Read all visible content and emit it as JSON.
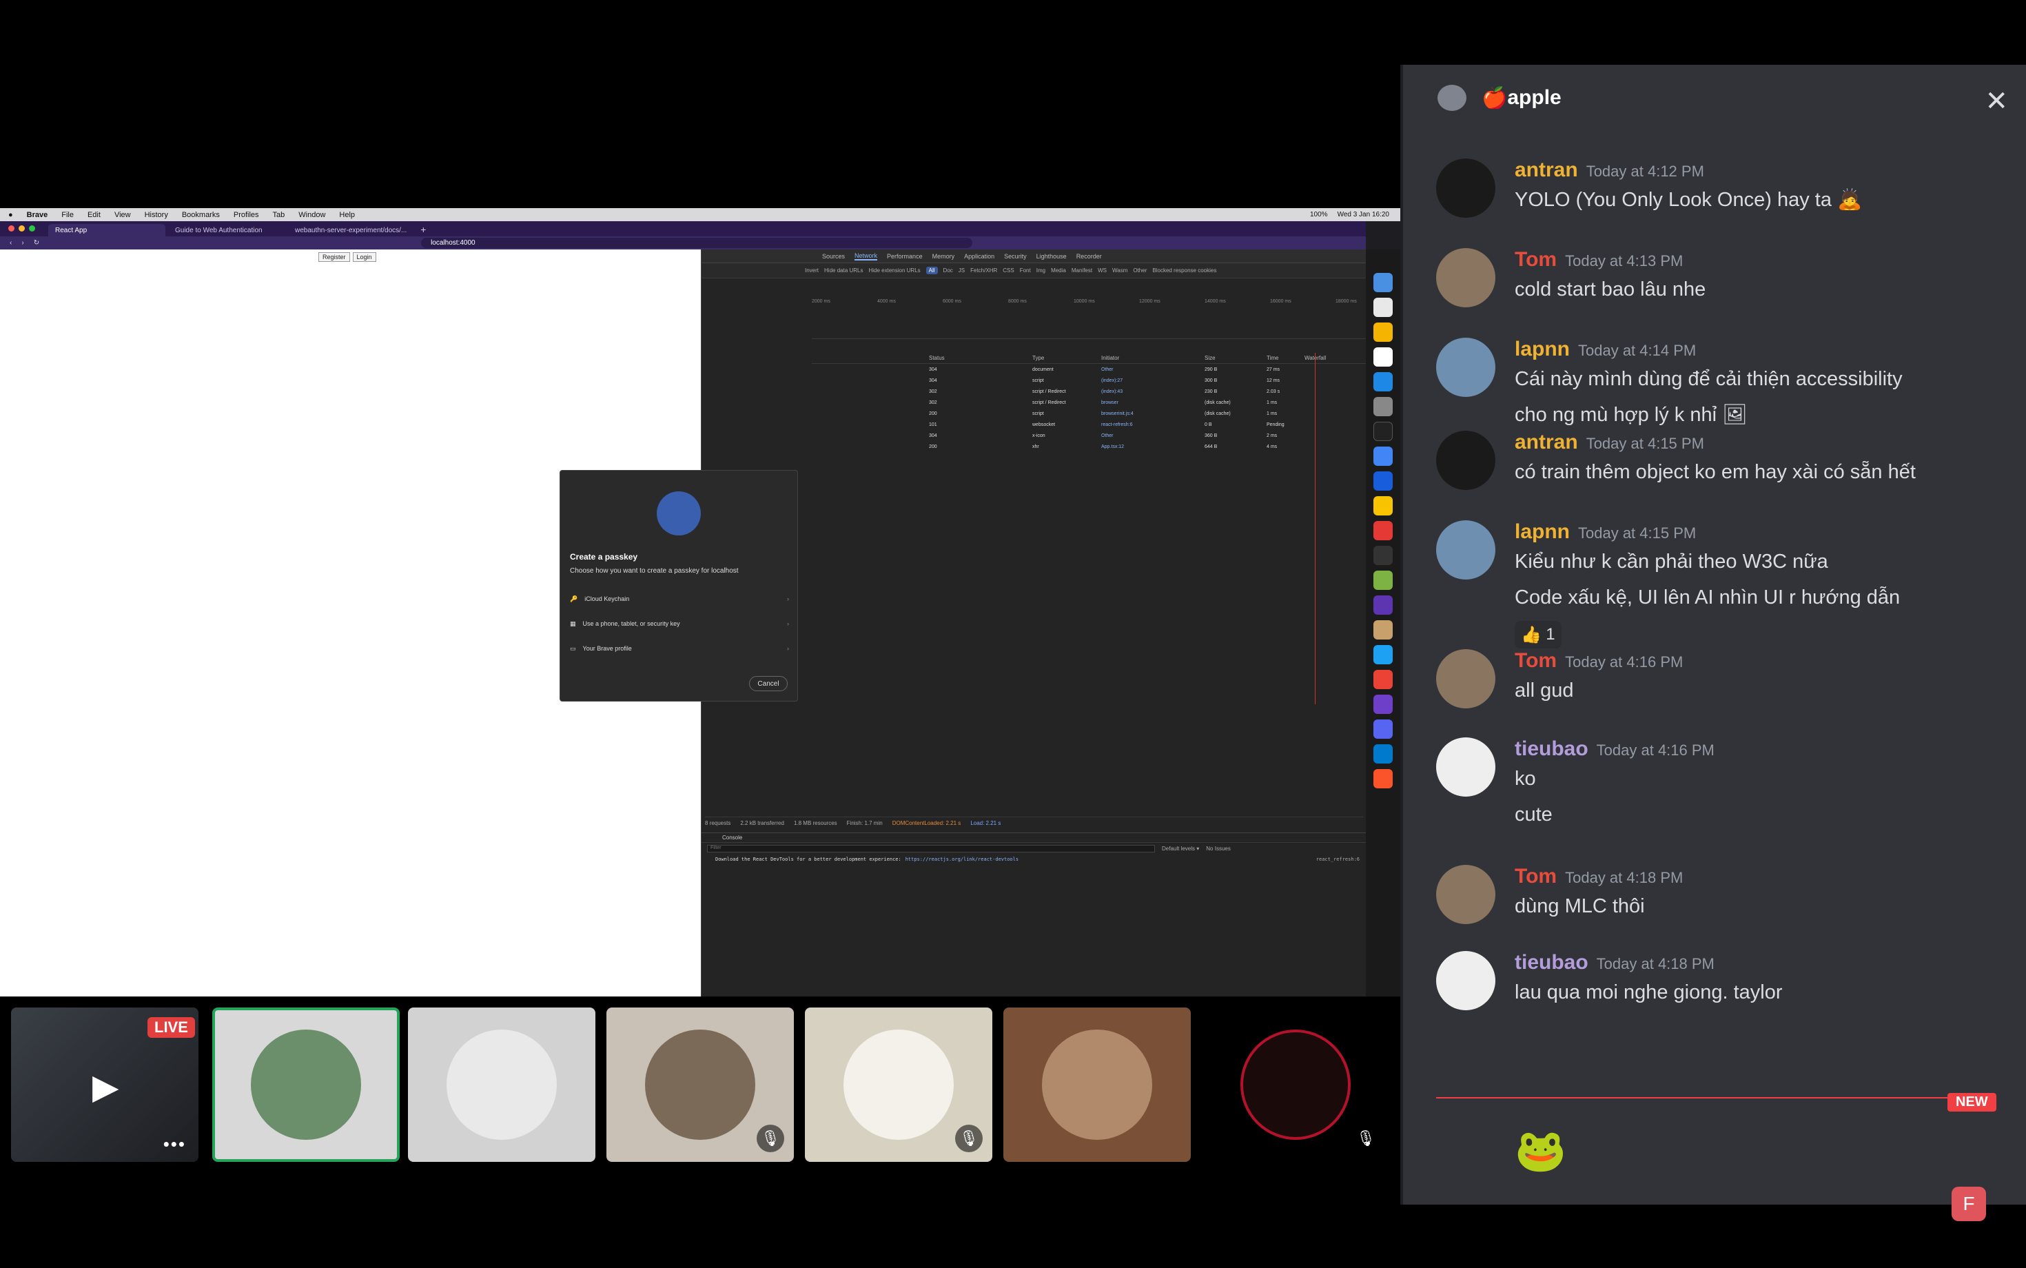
{
  "screenshare": {
    "menubar": {
      "app": "Brave",
      "items": [
        "File",
        "Edit",
        "View",
        "History",
        "Bookmarks",
        "Profiles",
        "Tab",
        "Window",
        "Help"
      ],
      "status": [
        "100%",
        "Wed 3 Jan 16:20"
      ]
    },
    "tabs": [
      {
        "label": "React App",
        "active": true
      },
      {
        "label": "Guide to Web Authentication",
        "active": false
      },
      {
        "label": "webauthn-server-experiment/docs/...",
        "active": false
      }
    ],
    "url": "localhost:4000",
    "page_buttons": [
      "Register",
      "Login"
    ],
    "passkey_dialog": {
      "title": "Create a passkey",
      "subtitle": "Choose how you want to create a passkey for localhost",
      "options": [
        "iCloud Keychain",
        "Use a phone, tablet, or security key",
        "Your Brave profile"
      ],
      "cancel": "Cancel"
    },
    "devtools": {
      "tabs": [
        "Sources",
        "Network",
        "Performance",
        "Memory",
        "Application",
        "Security",
        "Lighthouse",
        "Recorder"
      ],
      "active_tab": "Network",
      "filter_options": [
        "Invert",
        "Hide data URLs",
        "Hide extension URLs",
        "Blocked response cookies"
      ],
      "filter_chips": [
        "All",
        "Doc",
        "JS",
        "Fetch/XHR",
        "CSS",
        "Font",
        "Img",
        "Media",
        "Manifest",
        "WS",
        "Wasm",
        "Other"
      ],
      "timeline_ticks": [
        "2000 ms",
        "4000 ms",
        "6000 ms",
        "8000 ms",
        "10000 ms",
        "12000 ms",
        "14000 ms",
        "16000 ms",
        "18000 ms"
      ],
      "columns": [
        "Status",
        "Type",
        "Initiator",
        "Size",
        "Time",
        "Waterfall"
      ],
      "rows": [
        {
          "status": "304",
          "type": "document",
          "initiator": "Other",
          "size": "290 B",
          "time": "27 ms"
        },
        {
          "status": "304",
          "type": "script",
          "initiator": "(index):27",
          "size": "300 B",
          "time": "12 ms"
        },
        {
          "status": "302",
          "type": "script / Redirect",
          "initiator": "(index):43",
          "size": "230 B",
          "time": "2.03 s"
        },
        {
          "status": "302",
          "type": "script / Redirect",
          "initiator": "browser",
          "size": "(disk cache)",
          "time": "1 ms"
        },
        {
          "status": "200",
          "type": "script",
          "initiator": "browserinit.js:4",
          "size": "(disk cache)",
          "time": "1 ms"
        },
        {
          "status": "101",
          "type": "websocket",
          "initiator": "react-refresh:6",
          "size": "0 B",
          "time": "Pending"
        },
        {
          "status": "304",
          "type": "x-icon",
          "initiator": "Other",
          "size": "360 B",
          "time": "2 ms"
        },
        {
          "status": "200",
          "type": "xhr",
          "initiator": "App.tsx:12",
          "size": "644 B",
          "time": "4 ms"
        }
      ],
      "summary": [
        "8 requests",
        "2.2 kB transferred",
        "1.8 MB resources",
        "Finish: 1.7 min",
        "DOMContentLoaded: 2.21 s",
        "Load: 2.21 s"
      ],
      "console_tab": "Console",
      "console_filter": "Filter",
      "console_right": [
        "Default levels ▾",
        "No Issues"
      ],
      "console_message": "Download the React DevTools for a better development experience:",
      "console_link": "https://reactjs.org/link/react-devtools",
      "console_source": "react_refresh:6"
    }
  },
  "participants": {
    "live_label": "LIVE",
    "more": "•••"
  },
  "chat": {
    "channel": "apple",
    "channel_emoji": "🍎",
    "messages": [
      {
        "user": "antran",
        "color": "#f0b232",
        "time": "Today at 4:12 PM",
        "lines": [
          "YOLO (You Only Look Once) hay ta 🙇"
        ]
      },
      {
        "user": "Tom",
        "color": "#e74c3c",
        "time": "Today at 4:13 PM",
        "lines": [
          "cold start bao lâu nhe"
        ]
      },
      {
        "user": "lapnn",
        "color": "#f0b232",
        "time": "Today at 4:14 PM",
        "lines": [
          "Cái này mình dùng để cải thiện accessibility",
          "cho ng mù hợp lý k nhỉ 🖼"
        ]
      },
      {
        "user": "antran",
        "color": "#f0b232",
        "time": "Today at 4:15 PM",
        "lines": [
          "có train thêm object ko em hay xài có sẵn hết"
        ]
      },
      {
        "user": "lapnn",
        "color": "#f0b232",
        "time": "Today at 4:15 PM",
        "lines": [
          "Kiểu như k cần phải theo W3C nữa",
          "Code xấu kệ, UI lên AI nhìn UI r hướng dẫn"
        ],
        "reaction": {
          "emoji": "👍",
          "count": "1"
        }
      },
      {
        "user": "Tom",
        "color": "#e74c3c",
        "time": "Today at 4:16 PM",
        "lines": [
          "all gud"
        ]
      },
      {
        "user": "tieubao",
        "color": "#b39ddb",
        "time": "Today at 4:16 PM",
        "lines": [
          "ko",
          "cute"
        ]
      },
      {
        "user": "Tom",
        "color": "#e74c3c",
        "time": "Today at 4:18 PM",
        "lines": [
          "dùng MLC thôi"
        ]
      },
      {
        "user": "tieubao",
        "color": "#b39ddb",
        "time": "Today at 4:18 PM",
        "lines": [
          "lau qua moi nghe giong. taylor"
        ]
      }
    ],
    "new_label": "NEW",
    "sticker": "🐸"
  }
}
